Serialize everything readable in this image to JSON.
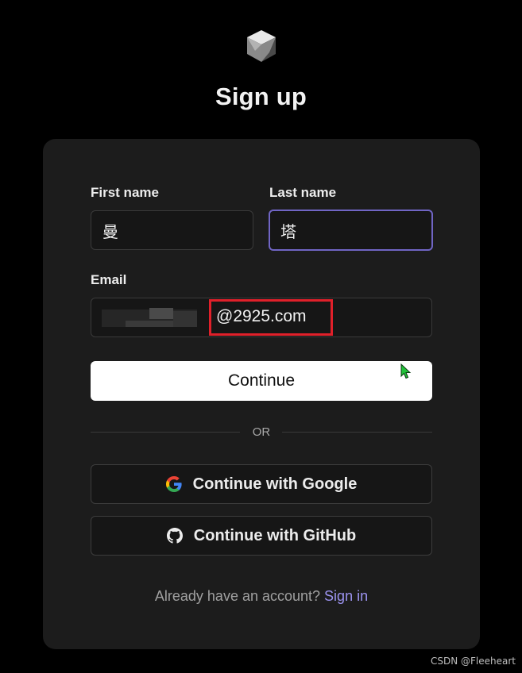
{
  "page": {
    "title": "Sign up",
    "logo_icon": "cube-logo-icon"
  },
  "form": {
    "first_name": {
      "label": "First name",
      "value": "曼"
    },
    "last_name": {
      "label": "Last name",
      "value": "塔"
    },
    "email": {
      "label": "Email",
      "value_visible_suffix": "@2925.com",
      "prefix_obscured": true
    },
    "continue_label": "Continue",
    "divider_text": "OR",
    "google_label": "Continue with Google",
    "github_label": "Continue with GitHub"
  },
  "footer": {
    "prompt": "Already have an account?",
    "link": "Sign in"
  },
  "watermark": "CSDN @Fleeheart",
  "colors": {
    "background": "#000000",
    "card": "#1c1c1c",
    "accent": "#7065c4",
    "link": "#9c93f0",
    "annotation": "#e0202a"
  }
}
